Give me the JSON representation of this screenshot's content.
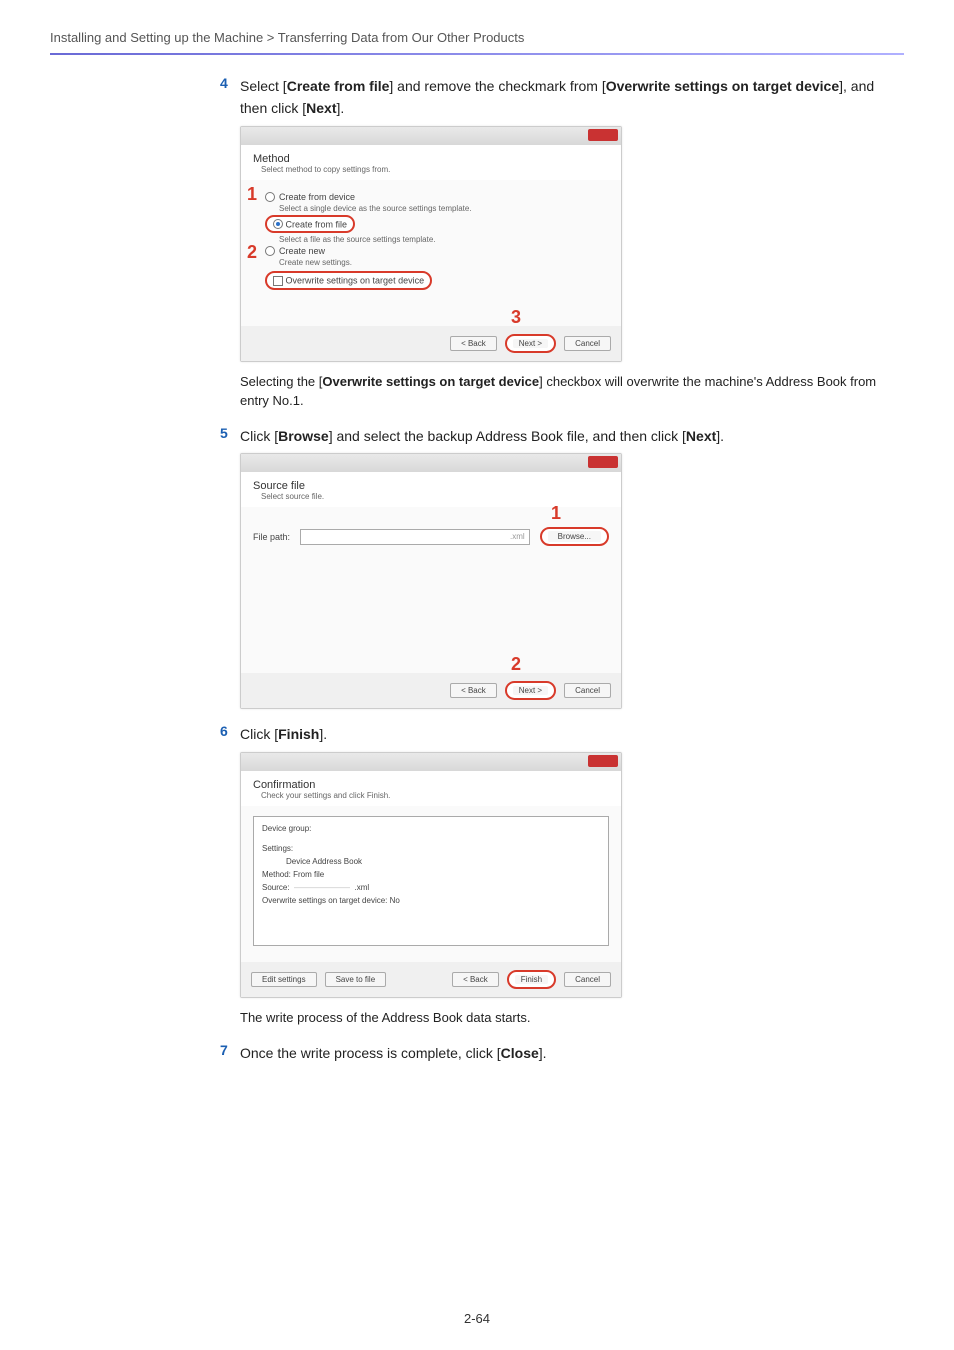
{
  "breadcrumb": "Installing and Setting up the Machine > Transferring Data from Our Other Products",
  "step4": {
    "num": "4",
    "text_before": "Select [",
    "bold1": "Create from file",
    "text_mid1": "] and remove the checkmark from [",
    "bold2": "Overwrite settings on target device",
    "text_mid2": "], and then click [",
    "bold3": "Next",
    "text_after": "]."
  },
  "wizard1": {
    "title": "Method",
    "subtitle": "Select method to copy settings from.",
    "opt1": "Create from device",
    "opt1_sub": "Select a single device as the source settings template.",
    "opt2": "Create from file",
    "opt2_sub": "Select a file as the source settings template.",
    "opt3": "Create new",
    "opt3_sub": "Create new settings.",
    "chk": "Overwrite settings on target device",
    "back": "< Back",
    "next": "Next >",
    "cancel": "Cancel"
  },
  "step4_note": {
    "t1": "Selecting the [",
    "b": "Overwrite settings on target device",
    "t2": "] checkbox will overwrite the machine's Address Book from entry No.1."
  },
  "step5": {
    "num": "5",
    "t1": "Click [",
    "b1": "Browse",
    "t2": "] and select the backup Address Book file, and then click [",
    "b2": "Next",
    "t3": "]."
  },
  "wizard2": {
    "title": "Source file",
    "subtitle": "Select source file.",
    "file_label": "File path:",
    "file_ext": ".xml",
    "browse": "Browse...",
    "back": "< Back",
    "next": "Next >",
    "cancel": "Cancel"
  },
  "step6": {
    "num": "6",
    "t1": "Click [",
    "b": "Finish",
    "t2": "]."
  },
  "wizard3": {
    "title": "Confirmation",
    "subtitle": "Check your settings and click Finish.",
    "l1": "Device group:",
    "l2": "Settings:",
    "l2_val": "Device Address Book",
    "l3": "Method: From file",
    "l4": "Source:",
    "l4_ext": ".xml",
    "l5": "Overwrite settings on target device: No",
    "edit_settings": "Edit settings",
    "save_to_file": "Save to file",
    "back": "< Back",
    "finish": "Finish",
    "cancel": "Cancel"
  },
  "step6_note": "The write process of the Address Book data starts.",
  "step7": {
    "num": "7",
    "t1": "Once the write process is complete, click [",
    "b": "Close",
    "t2": "]."
  },
  "markers": {
    "m1": "1",
    "m2": "2",
    "m3": "3"
  },
  "page_num": "2-64"
}
